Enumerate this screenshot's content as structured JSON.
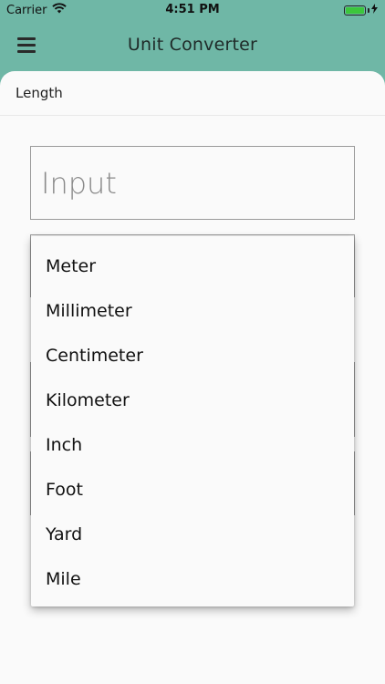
{
  "status_bar": {
    "carrier": "Carrier",
    "time": "4:51 PM",
    "battery_level": 1.0,
    "battery_color": "#3cc63c"
  },
  "app_bar": {
    "title": "Unit Converter",
    "menu_icon": "hamburger-menu-icon",
    "background": "#6fb7a6"
  },
  "tab": {
    "label": "Length"
  },
  "input": {
    "placeholder": "Input",
    "value": ""
  },
  "dropdown": {
    "options": [
      "Meter",
      "Millimeter",
      "Centimeter",
      "Kilometer",
      "Inch",
      "Foot",
      "Yard",
      "Mile"
    ]
  }
}
